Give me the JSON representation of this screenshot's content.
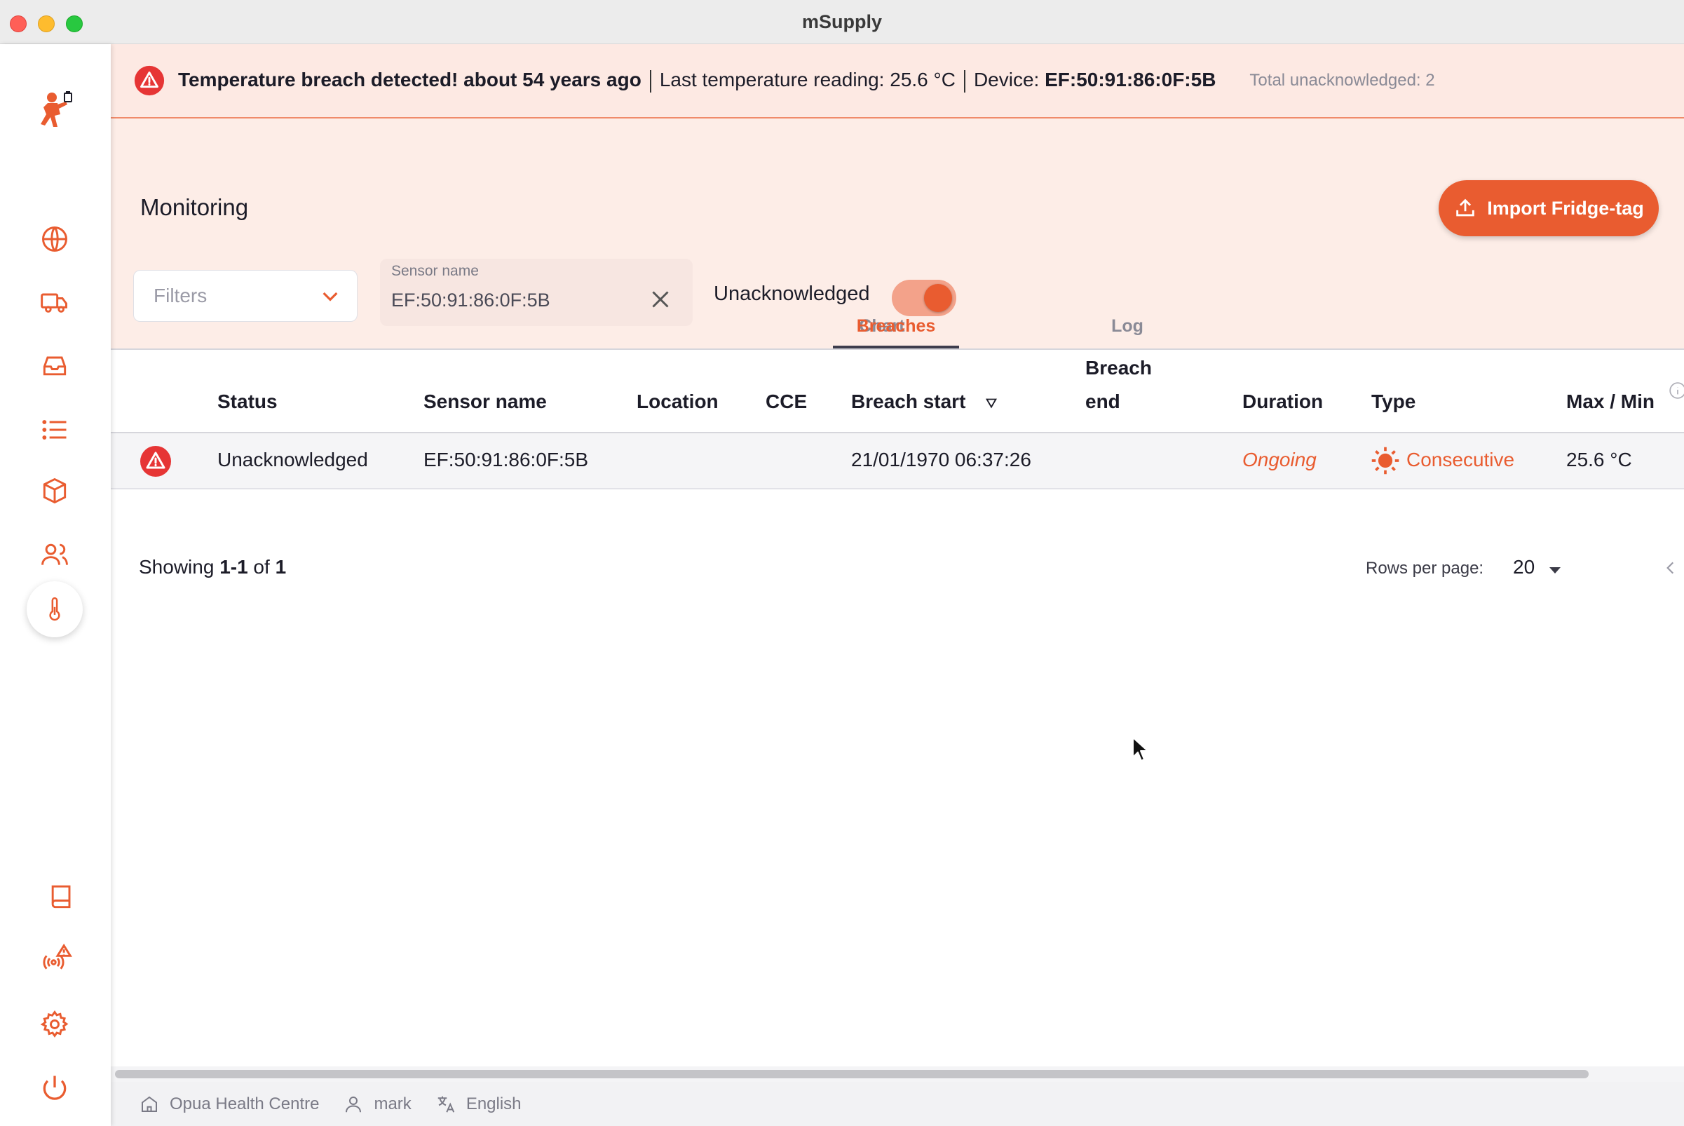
{
  "window": {
    "title": "mSupply"
  },
  "alert": {
    "headline": "Temperature breach detected! about 54 years ago",
    "reading_label": "Last temperature reading: ",
    "reading_value": "25.6 °C",
    "device_label": "Device: ",
    "device_value": "EF:50:91:86:0F:5B",
    "total": "Total unacknowledged: 2"
  },
  "page": {
    "title": "Monitoring",
    "import_label": "Import Fridge-tag"
  },
  "filters": {
    "placeholder": "Filters",
    "sensor_label": "Sensor name",
    "sensor_value": "EF:50:91:86:0F:5B",
    "toggle_label": "Unacknowledged",
    "toggle_on": true
  },
  "tabs": [
    {
      "label": "Chart",
      "active": false
    },
    {
      "label": "Breaches",
      "active": true
    },
    {
      "label": "Log",
      "active": false
    }
  ],
  "table": {
    "columns": {
      "status": "Status",
      "sensor": "Sensor name",
      "location": "Location",
      "cce": "CCE",
      "breach_start": "Breach start",
      "breach_end_1": "Breach",
      "breach_end_2": "end",
      "duration": "Duration",
      "type": "Type",
      "maxmin": "Max / Min"
    },
    "rows": [
      {
        "status": "Unacknowledged",
        "sensor": "EF:50:91:86:0F:5B",
        "location": "",
        "cce": "",
        "breach_start": "21/01/1970 06:37:26",
        "breach_end": "",
        "duration": "Ongoing",
        "type": "Consecutive",
        "maxmin": "25.6 °C"
      }
    ]
  },
  "footer": {
    "showing_prefix": "Showing ",
    "showing_range": "1-1",
    "showing_of": " of ",
    "showing_total": "1",
    "rows_per_page_label": "Rows per page:",
    "rows_per_page_value": "20"
  },
  "statusbar": {
    "store": "Opua Health Centre",
    "user": "mark",
    "language": "English"
  },
  "colors": {
    "accent": "#e95c30",
    "alert_bg": "#fde9e3",
    "header_bg": "#fdede7",
    "danger": "#e63535"
  }
}
